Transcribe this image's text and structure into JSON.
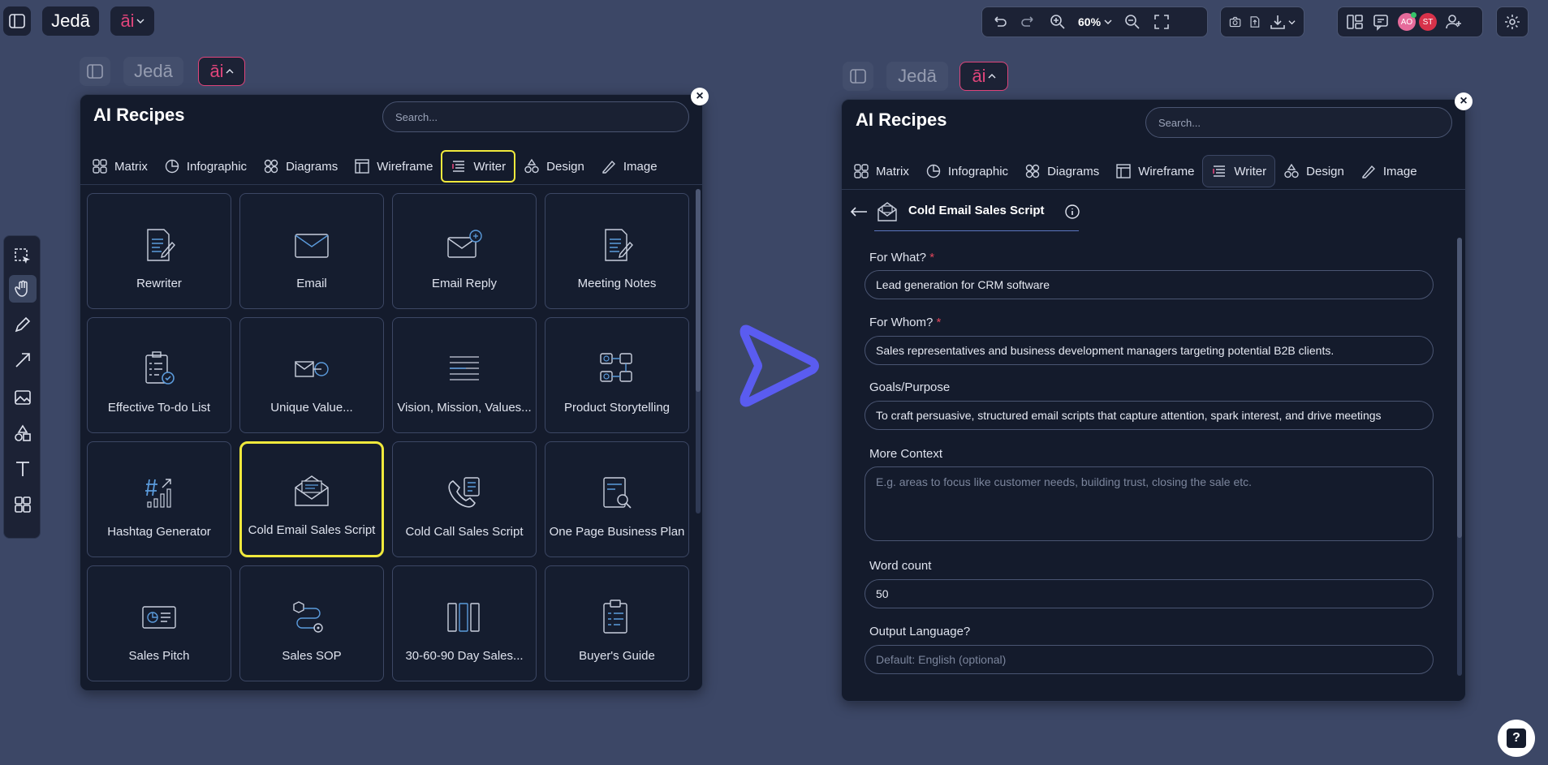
{
  "topbar": {
    "logo_text": "Jedā",
    "ai_label": "āi",
    "zoom": "60%",
    "avatars": [
      "AO",
      "ST"
    ],
    "accent_color": "#e0457b"
  },
  "header_left": {
    "logo_text": "Jedā",
    "ai_label": "āi"
  },
  "header_right": {
    "logo_text": "Jedā",
    "ai_label": "āi"
  },
  "left_panel": {
    "title": "AI Recipes",
    "search_placeholder": "Search...",
    "tabs": [
      {
        "label": "Matrix",
        "icon": "matrix-icon"
      },
      {
        "label": "Infographic",
        "icon": "infographic-icon"
      },
      {
        "label": "Diagrams",
        "icon": "diagrams-icon"
      },
      {
        "label": "Wireframe",
        "icon": "wireframe-icon"
      },
      {
        "label": "Writer",
        "icon": "writer-icon",
        "selected": true
      },
      {
        "label": "Design",
        "icon": "design-icon"
      },
      {
        "label": "Image",
        "icon": "image-icon"
      }
    ],
    "cards": [
      {
        "label": "Rewriter",
        "icon": "rewriter-icon"
      },
      {
        "label": "Email",
        "icon": "email-icon"
      },
      {
        "label": "Email Reply",
        "icon": "email-reply-icon"
      },
      {
        "label": "Meeting Notes",
        "icon": "meeting-notes-icon"
      },
      {
        "label": "Effective To-do List",
        "icon": "todo-list-icon"
      },
      {
        "label": "Unique Value...",
        "icon": "unique-value-icon"
      },
      {
        "label": "Vision, Mission, Values...",
        "icon": "vision-mission-icon"
      },
      {
        "label": "Product Storytelling",
        "icon": "storytelling-icon"
      },
      {
        "label": "Hashtag Generator",
        "icon": "hashtag-icon"
      },
      {
        "label": "Cold Email Sales Script",
        "icon": "cold-email-icon",
        "highlighted": true
      },
      {
        "label": "Cold Call Sales Script",
        "icon": "cold-call-icon"
      },
      {
        "label": "One Page Business Plan",
        "icon": "business-plan-icon"
      },
      {
        "label": "Sales Pitch",
        "icon": "sales-pitch-icon"
      },
      {
        "label": "Sales SOP",
        "icon": "sales-sop-icon"
      },
      {
        "label": "30-60-90 Day Sales...",
        "icon": "sales-plan-icon"
      },
      {
        "label": "Buyer's Guide",
        "icon": "buyers-guide-icon"
      }
    ]
  },
  "right_panel": {
    "title": "AI Recipes",
    "search_placeholder": "Search...",
    "tabs": [
      "Matrix",
      "Infographic",
      "Diagrams",
      "Wireframe",
      "Writer",
      "Design",
      "Image"
    ],
    "recipe_title": "Cold Email Sales Script",
    "fields": [
      {
        "label": "For What?",
        "required": true,
        "value": "Lead generation for CRM software",
        "placeholder": ""
      },
      {
        "label": "For Whom?",
        "required": true,
        "value": "Sales representatives and business development managers targeting potential B2B clients.",
        "placeholder": ""
      },
      {
        "label": "Goals/Purpose",
        "required": false,
        "value": "To craft persuasive, structured email scripts that capture attention, spark interest, and drive meetings",
        "placeholder": ""
      },
      {
        "label": "More Context",
        "required": false,
        "value": "",
        "placeholder": "E.g. areas to focus like customer needs, building trust, closing the sale etc."
      },
      {
        "label": "Word count",
        "required": false,
        "value": "50",
        "placeholder": ""
      },
      {
        "label": "Output Language?",
        "required": false,
        "value": "",
        "placeholder": "Default: English (optional)"
      }
    ]
  },
  "help_label": "?",
  "close_label": "×",
  "required_mark": "*"
}
